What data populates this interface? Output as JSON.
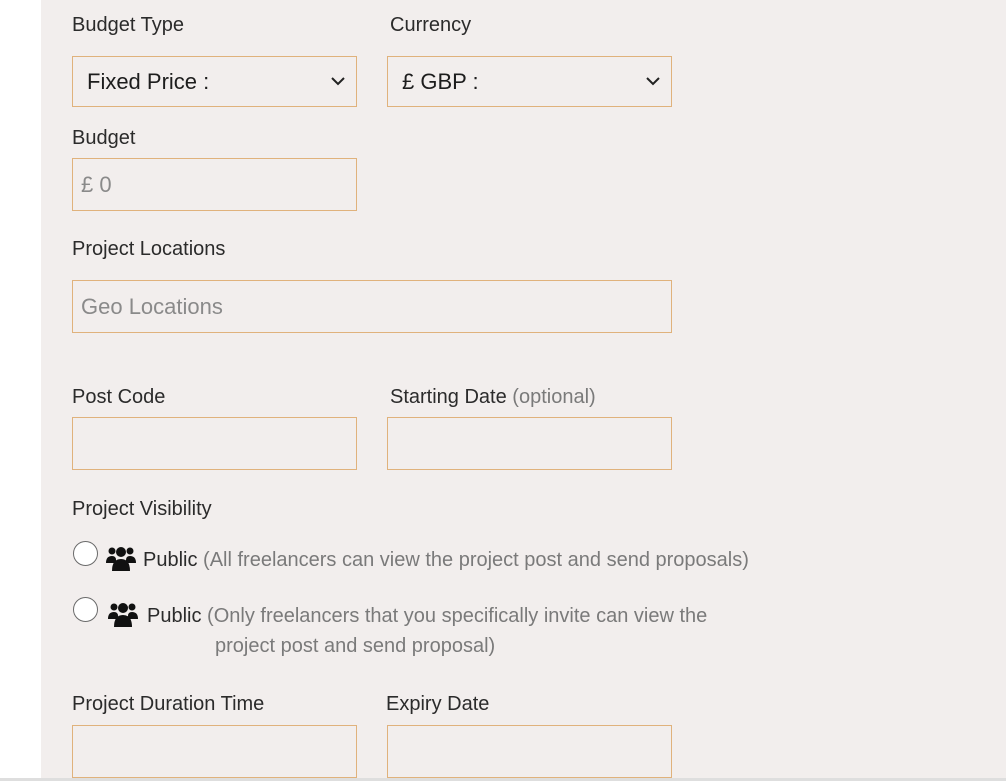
{
  "budget_type": {
    "label": "Budget Type",
    "selected": "Fixed Price :"
  },
  "currency": {
    "label": "Currency",
    "selected": "£ GBP :"
  },
  "budget": {
    "label": "Budget",
    "value": "£ 0"
  },
  "project_locations": {
    "label": "Project Locations",
    "placeholder": "Geo Locations"
  },
  "post_code": {
    "label": "Post Code",
    "value": ""
  },
  "starting_date": {
    "label": "Starting Date",
    "optional": "(optional)",
    "value": ""
  },
  "visibility": {
    "label": "Project Visibility",
    "options": [
      {
        "title": "Public",
        "description": "(All freelancers can view the project post and send proposals)",
        "icon": "users-icon"
      },
      {
        "title": "Public",
        "description_line1": "(Only freelancers that you specifically invite can view the",
        "description_line2": "project post and send proposal)",
        "icon": "users-icon"
      }
    ]
  },
  "duration": {
    "label": "Project Duration Time",
    "value": ""
  },
  "expiry": {
    "label": "Expiry Date",
    "value": ""
  }
}
